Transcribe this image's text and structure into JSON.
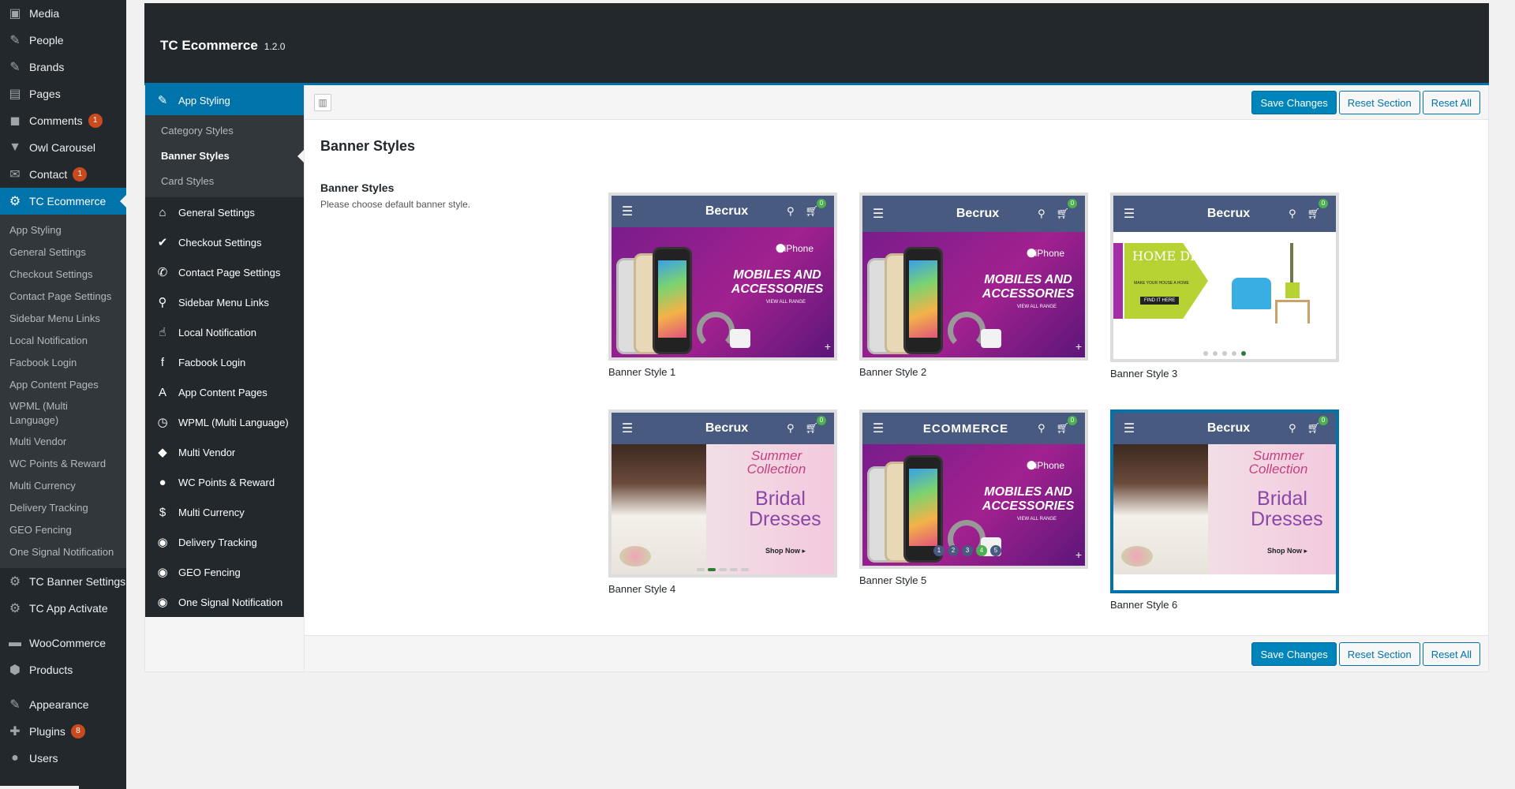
{
  "wp_menu": {
    "items": [
      {
        "label": "Media",
        "icon": "media-icon"
      },
      {
        "label": "People",
        "icon": "pin-icon"
      },
      {
        "label": "Brands",
        "icon": "pin-icon"
      },
      {
        "label": "Pages",
        "icon": "pages-icon"
      },
      {
        "label": "Comments",
        "icon": "comments-icon",
        "badge": "1"
      },
      {
        "label": "Owl Carousel",
        "icon": "owl-icon"
      },
      {
        "label": "Contact",
        "icon": "mail-icon",
        "badge": "1"
      },
      {
        "label": "TC Ecommerce",
        "icon": "gear-icon",
        "current": true
      }
    ],
    "submenu": [
      "App Styling",
      "General Settings",
      "Checkout Settings",
      "Contact Page Settings",
      "Sidebar Menu Links",
      "Local Notification",
      "Facbook Login",
      "App Content Pages",
      "WPML (Multi Language)",
      "Multi Vendor",
      "WC Points & Reward",
      "Multi Currency",
      "Delivery Tracking",
      "GEO Fencing",
      "One Signal Notification"
    ],
    "lower_items": [
      {
        "label": "TC Banner Settings",
        "icon": "gear-icon"
      },
      {
        "label": "TC App Activate",
        "icon": "gear-icon"
      },
      {
        "label": "WooCommerce",
        "icon": "woo-icon"
      },
      {
        "label": "Products",
        "icon": "box-icon"
      },
      {
        "label": "Appearance",
        "icon": "brush-icon"
      },
      {
        "label": "Plugins",
        "icon": "plugin-icon",
        "badge": "8"
      },
      {
        "label": "Users",
        "icon": "user-icon"
      }
    ]
  },
  "plugin": {
    "title": "TC Ecommerce",
    "version": "1.2.0"
  },
  "nav": {
    "active": "App Styling",
    "subitems": [
      "Category Styles",
      "Banner Styles",
      "Card Styles"
    ],
    "active_sub": "Banner Styles",
    "items": [
      {
        "label": "General Settings",
        "icon": "home-icon"
      },
      {
        "label": "Checkout Settings",
        "icon": "check-icon"
      },
      {
        "label": "Contact Page Settings",
        "icon": "phone-icon"
      },
      {
        "label": "Sidebar Menu Links",
        "icon": "link-icon"
      },
      {
        "label": "Local Notification",
        "icon": "thumbs-up-icon"
      },
      {
        "label": "Facbook Login",
        "icon": "facebook-icon"
      },
      {
        "label": "App Content Pages",
        "icon": "font-icon"
      },
      {
        "label": "WPML (Multi Language)",
        "icon": "clock-icon"
      },
      {
        "label": "Multi Vendor",
        "icon": "tags-icon"
      },
      {
        "label": "WC Points & Reward",
        "icon": "drop-icon"
      },
      {
        "label": "Multi Currency",
        "icon": "dollar-icon"
      },
      {
        "label": "Delivery Tracking",
        "icon": "circle-icon"
      },
      {
        "label": "GEO Fencing",
        "icon": "circle-icon"
      },
      {
        "label": "One Signal Notification",
        "icon": "circle-icon"
      }
    ]
  },
  "toolbar": {
    "save": "Save Changes",
    "reset_section": "Reset Section",
    "reset_all": "Reset All"
  },
  "section": {
    "title": "Banner Styles",
    "field_label": "Banner Styles",
    "field_desc": "Please choose default banner style."
  },
  "banners": [
    {
      "caption": "Banner Style 1",
      "brand": "Becrux",
      "cart": "0",
      "promo": "MOBILES AND ACCESSORIES",
      "iphone": "iPhone",
      "range": "VIEW ALL RANGE"
    },
    {
      "caption": "Banner Style 2",
      "brand": "Becrux",
      "cart": "0",
      "promo": "MOBILES AND ACCESSORIES",
      "iphone": "iPhone",
      "range": "VIEW ALL RANGE"
    },
    {
      "caption": "Banner Style 3",
      "brand": "Becrux",
      "cart": "0",
      "decor_title": "HOME DECOR",
      "decor_sub": "MAKE YOUR HOUSE A HOME",
      "decor_btn": "FIND IT HERE"
    },
    {
      "caption": "Banner Style 4",
      "brand": "Becrux",
      "cart": "0",
      "summer": "Summer Collection",
      "bridal": "Bridal Dresses",
      "shop": "Shop Now ▸"
    },
    {
      "caption": "Banner Style 5",
      "brand": "ECOMMERCE",
      "cart": "0",
      "promo": "MOBILES AND ACCESSORIES",
      "iphone": "iPhone",
      "range": "VIEW ALL RANGE",
      "nums": [
        "1",
        "2",
        "3",
        "4",
        "5"
      ]
    },
    {
      "caption": "Banner Style 6",
      "brand": "Becrux",
      "cart": "0",
      "summer": "Summer Collection",
      "bridal": "Bridal Dresses",
      "shop": "Shop Now ▸",
      "selected": true
    }
  ]
}
